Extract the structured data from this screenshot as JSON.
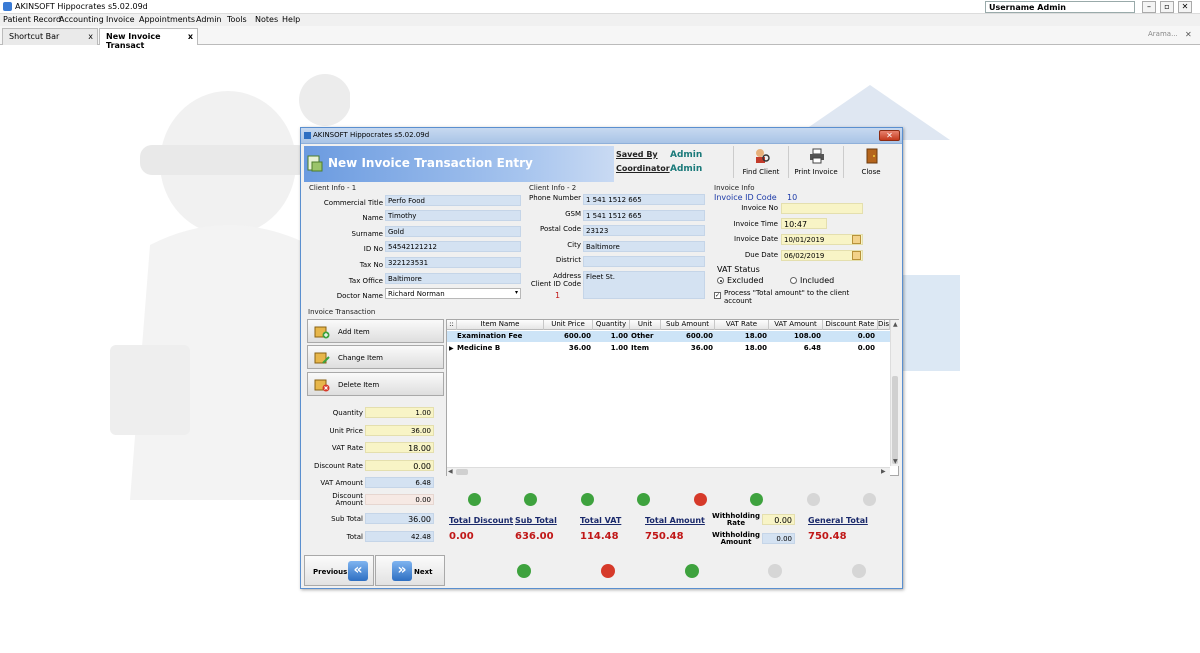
{
  "app": {
    "title": "AKINSOFT Hippocrates s5.02.09d",
    "username": "Username Admin",
    "window_min": "–",
    "window_max": "▫",
    "window_close": "✕"
  },
  "menu": [
    "Patient Record",
    "Accounting",
    "Invoice",
    "Appointments",
    "Admin",
    "Tools",
    "Notes",
    "Help"
  ],
  "tabs": [
    {
      "label": "Shortcut Bar",
      "close": "x"
    },
    {
      "label": "New Invoice Transact",
      "close": "x"
    }
  ],
  "tabbar": {
    "search": "Arama...",
    "close": "✕"
  },
  "dialog": {
    "window_title": "AKINSOFT Hippocrates s5.02.09d",
    "close": "✕",
    "heading": "New Invoice Transaction Entry",
    "saved_by_label": "Saved By",
    "saved_by_value": "Admin",
    "coordinator_label": "Coordinator",
    "coordinator_value": "Admin",
    "toolbar": {
      "find_client": "Find Client",
      "print_invoice": "Print Invoice",
      "close": "Close"
    }
  },
  "client1": {
    "title": "Client Info - 1",
    "fields": [
      {
        "label": "Commercial Title",
        "value": "Perfo Food"
      },
      {
        "label": "Name",
        "value": "Timothy"
      },
      {
        "label": "Surname",
        "value": "Gold"
      },
      {
        "label": "ID No",
        "value": "54542121212"
      },
      {
        "label": "Tax No",
        "value": "322123531"
      },
      {
        "label": "Tax Office",
        "value": "Baltimore"
      },
      {
        "label": "Doctor Name",
        "value": "Richard Norman"
      }
    ],
    "dropdown": "▾"
  },
  "client2": {
    "title": "Client Info - 2",
    "fields": [
      {
        "label": "Phone Number",
        "value": "1 541 1512 665"
      },
      {
        "label": "GSM",
        "value": "1 541 1512 665"
      },
      {
        "label": "Postal Code",
        "value": "23123"
      },
      {
        "label": "City",
        "value": "Baltimore"
      },
      {
        "label": "District",
        "value": ""
      }
    ],
    "address_label": "Address",
    "address_value": "Fleet St.",
    "client_id_label": "Client ID Code",
    "client_id_value": "1"
  },
  "invoice_info": {
    "title": "Invoice Info",
    "id_label": "Invoice ID Code",
    "id_value": "10",
    "no_label": "Invoice No",
    "no_value": "",
    "time_label": "Invoice Time",
    "time_value": "10:47",
    "date_label": "Invoice Date",
    "date_value": "10/01/2019",
    "due_label": "Due Date",
    "due_value": "06/02/2019",
    "vat_status_label": "VAT Status",
    "vat_excluded": "Excluded",
    "vat_included": "Included",
    "process_label": "Process \"Total amount\" to the client account",
    "check_mark": "✓"
  },
  "transaction": {
    "title": "Invoice Transaction",
    "add_item": "Add Item",
    "change_item": "Change Item",
    "delete_item": "Delete Item",
    "fields": [
      {
        "label": "Quantity",
        "value": "1.00"
      },
      {
        "label": "Unit Price",
        "value": "36.00"
      },
      {
        "label": "VAT Rate",
        "value": "18.00"
      },
      {
        "label": "Discount Rate",
        "value": "0.00"
      },
      {
        "label": "VAT Amount",
        "value": "6.48"
      },
      {
        "label": "Discount Amount",
        "value": "0.00"
      },
      {
        "label": "Sub Total",
        "value": "36.00"
      },
      {
        "label": "Total",
        "value": "42.48"
      }
    ]
  },
  "grid": {
    "corner": "::",
    "columns": [
      "Item Name",
      "Unit Price",
      "Quantity",
      "Unit",
      "Sub Amount",
      "VAT Rate",
      "VAT Amount",
      "Discount Rate",
      "Dis"
    ],
    "rows": [
      {
        "marker": "",
        "item": "Examination Fee",
        "unit_price": "600.00",
        "quantity": "1.00",
        "unit": "Other",
        "sub_amount": "600.00",
        "vat_rate": "18.00",
        "vat_amount": "108.00",
        "discount_rate": "0.00"
      },
      {
        "marker": "▶",
        "item": "Medicine B",
        "unit_price": "36.00",
        "quantity": "1.00",
        "unit": "Item",
        "sub_amount": "36.00",
        "vat_rate": "18.00",
        "vat_amount": "6.48",
        "discount_rate": "0.00"
      }
    ],
    "up": "▲",
    "down": "▼",
    "left": "◀",
    "right": "▶"
  },
  "nav_icons": [
    "first-record-icon",
    "previous-record-icon",
    "next-record-icon",
    "last-record-icon",
    "delete-record-icon",
    "refresh-icon",
    "confirm-icon",
    "cancel-icon"
  ],
  "totals": {
    "total_discount_label": "Total Discount",
    "total_discount": "0.00",
    "sub_total_label": "Sub Total",
    "sub_total": "636.00",
    "total_vat_label": "Total VAT",
    "total_vat": "114.48",
    "total_amount_label": "Total Amount",
    "total_amount": "750.48",
    "withholding_rate_label": "Withholding Rate",
    "withholding_rate": "0.00",
    "withholding_amount_label": "Withholding Amount",
    "withholding_amount": "0.00",
    "general_total_label": "General Total",
    "general_total": "750.48"
  },
  "footer": {
    "previous": "Previous",
    "next": "Next",
    "prev_arrow": "«",
    "next_arrow": "»"
  },
  "colors": {
    "accent": "#2e6fc2",
    "total_red": "#c01717",
    "field_blue": "#d4e2f2",
    "field_yellow": "#f8f4c6"
  }
}
